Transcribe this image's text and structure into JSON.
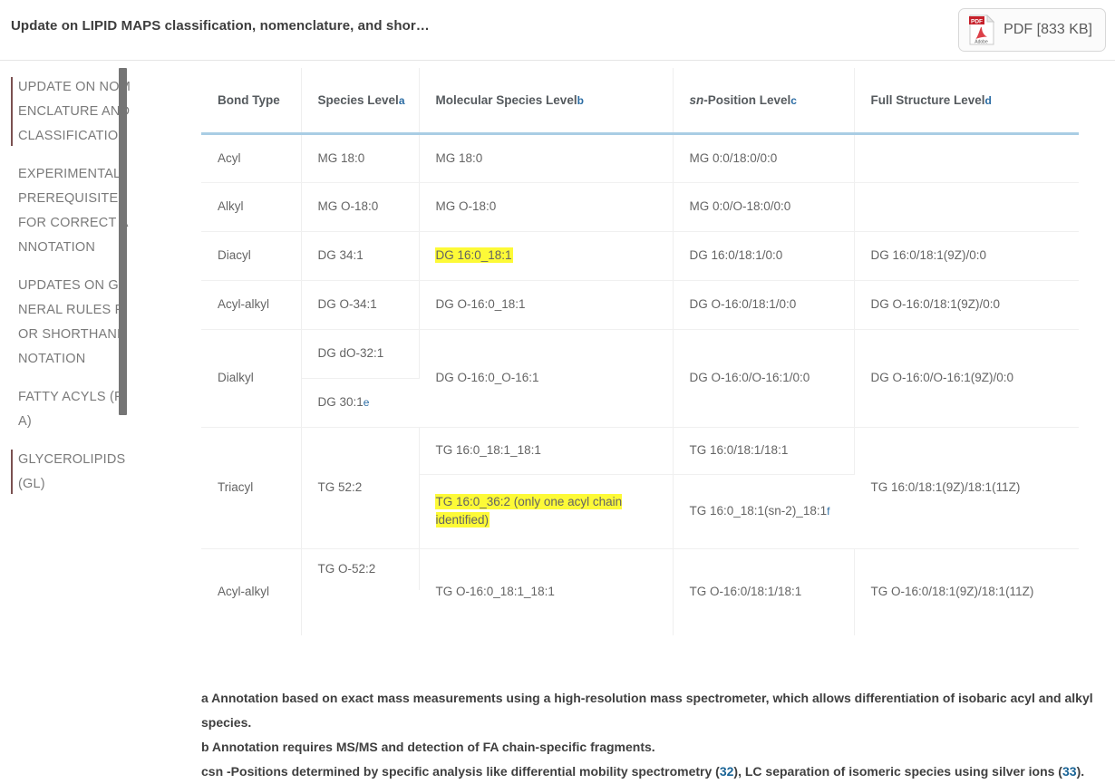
{
  "topbar": {
    "title": "Update on LIPID MAPS classification, nomenclature, and shor…",
    "pdf_label": "PDF [833 KB]",
    "pdf_icon": "pdf-adobe-icon",
    "pdf_badge": "PDF",
    "pdf_brand": "Adobe"
  },
  "sidebar": {
    "items": [
      {
        "label": "UPDATE ON NOMENCLATURE AND CLASSIFICATION",
        "active": true
      },
      {
        "label": "EXPERIMENTAL PREREQUISITES FOR CORRECT ANNOTATION",
        "active": false
      },
      {
        "label": "UPDATES ON GENERAL RULES FOR SHORTHAND NOTATION",
        "active": false
      },
      {
        "label": "FATTY ACYLS (FA)",
        "active": false
      },
      {
        "label": "GLYCEROLIPIDS (GL)",
        "active": true
      }
    ]
  },
  "table": {
    "headers": [
      {
        "text": "Bond Type",
        "sup": ""
      },
      {
        "text": "Species Level",
        "sup": "a"
      },
      {
        "text": "Molecular Species Level",
        "sup": "b"
      },
      {
        "text": "sn-Position Level",
        "sup": "c",
        "italic_prefix": "sn"
      },
      {
        "text": "Full Structure Level",
        "sup": "d"
      }
    ],
    "rows": [
      {
        "bond_type": "Acyl",
        "species": "MG 18:0",
        "molecular": "MG 18:0",
        "sn_position": "MG 0:0/18:0/0:0",
        "full_structure": ""
      },
      {
        "bond_type": "Alkyl",
        "species": "MG O-18:0",
        "molecular": "MG O-18:0",
        "sn_position": "MG 0:0/O-18:0/0:0",
        "full_structure": ""
      },
      {
        "bond_type": "Diacyl",
        "species": "DG 34:1",
        "molecular": "DG 16:0_18:1",
        "molecular_highlighted": true,
        "sn_position": "DG 16:0/18:1/0:0",
        "full_structure": "DG 16:0/18:1(9Z)/0:0"
      },
      {
        "bond_type": "Acyl-alkyl",
        "species": "DG O-34:1",
        "molecular": "DG O-16:0_18:1",
        "sn_position": "DG O-16:0/18:1/0:0",
        "full_structure": "DG O-16:0/18:1(9Z)/0:0"
      },
      {
        "bond_type": "Dialkyl",
        "species_multi": [
          {
            "text": "DG dO-32:1",
            "sup": ""
          },
          {
            "text": "DG 30:1",
            "sup": "e"
          }
        ],
        "molecular": "DG O-16:0_O-16:1",
        "sn_position": "DG O-16:0/O-16:1/0:0",
        "full_structure": "DG O-16:0/O-16:1(9Z)/0:0"
      },
      {
        "bond_type": "Triacyl",
        "species": "TG 52:2",
        "molecular_multi": [
          {
            "text": "TG 16:0_18:1_18:1",
            "highlighted": false
          },
          {
            "text": "TG 16:0_36:2 (only one acyl chain identified)",
            "highlighted": true
          }
        ],
        "sn_multi": [
          {
            "text": "TG 16:0/18:1/18:1",
            "sup": ""
          },
          {
            "text": "TG 16:0_18:1(sn-2)_18:1",
            "sup": "f"
          }
        ],
        "full_structure": "TG 16:0/18:1(9Z)/18:1(11Z)"
      },
      {
        "bond_type": "Acyl-alkyl",
        "species_multi": [
          {
            "text": "TG O-52:2",
            "sup": ""
          },
          {
            "text": "",
            "sup": ""
          }
        ],
        "molecular": "TG O-16:0_18:1_18:1",
        "sn_position": "TG O-16:0/18:1/18:1",
        "full_structure": "TG O-16:0/18:1(9Z)/18:1(11Z)"
      }
    ]
  },
  "footnotes": [
    {
      "text": "a Annotation based on exact mass measurements using a high-resolution mass spectrometer, which allows differentiation of isobaric acyl and alkyl species."
    },
    {
      "text": "b Annotation requires MS/MS and detection of FA chain-specific fragments."
    },
    {
      "prefix": "csn -Positions determined by specific analysis like differential mobility spectrometry (",
      "ref1": "32",
      "middle": "), LC separation of isomeric species using silver ions (",
      "ref2": "33",
      "suffix": ")."
    }
  ],
  "colors": {
    "header_underline": "#a9cde4",
    "highlight": "#fdfa37",
    "link": "#1a6496",
    "sidebar_accent": "#7a5050",
    "scrollbar": "#757575"
  }
}
